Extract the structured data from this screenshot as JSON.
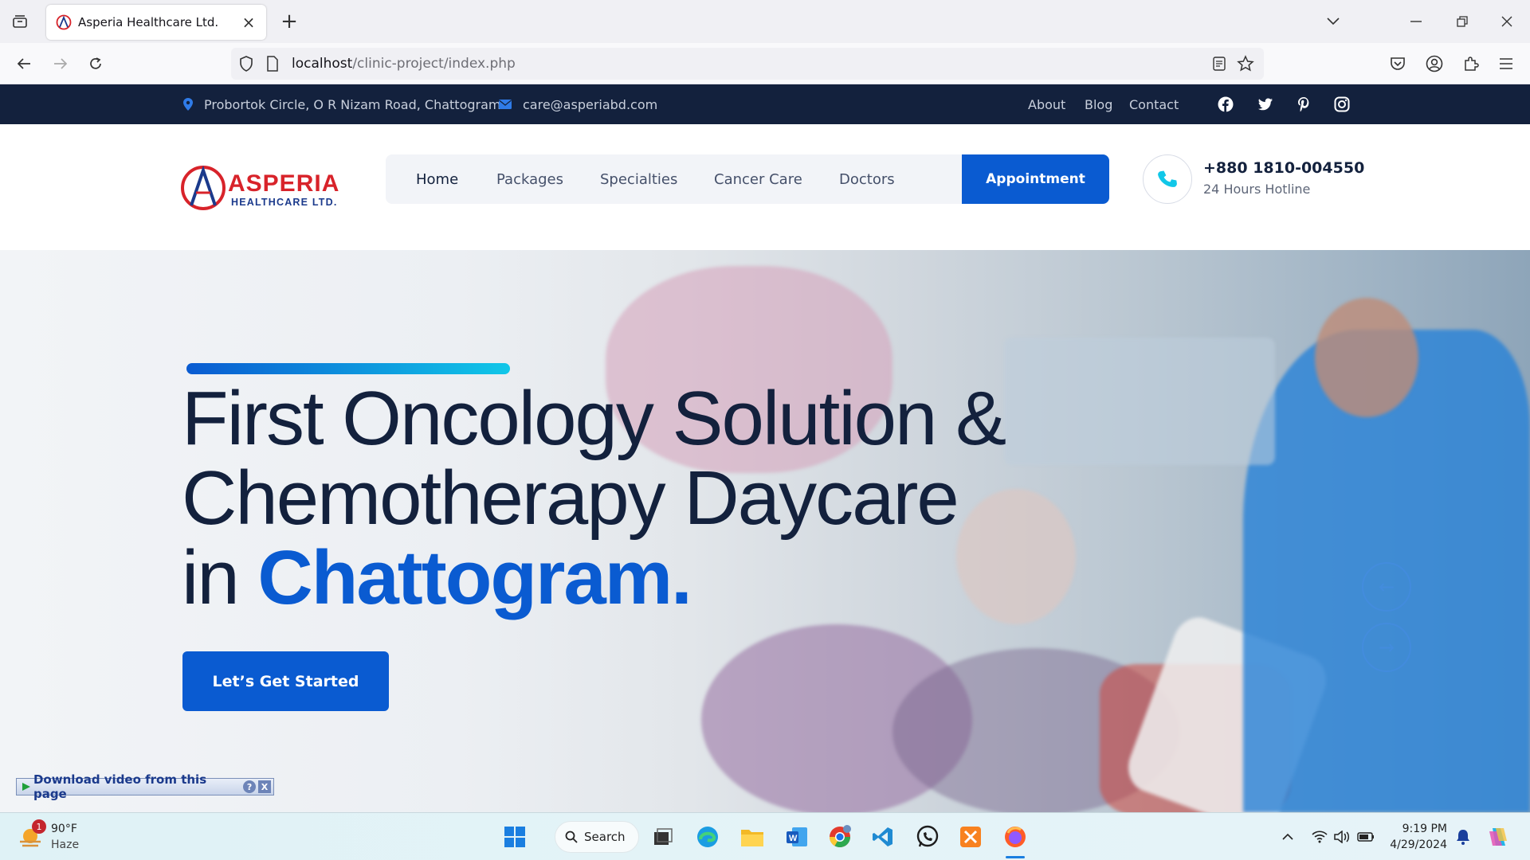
{
  "browser": {
    "tab_title": "Asperia Healthcare Ltd.",
    "tab_close": "×",
    "new_tab": "+",
    "url_host": "localhost",
    "url_path": "/clinic-project/index.php"
  },
  "topbar": {
    "address": "Probortok Circle, O R Nizam Road, Chattogram",
    "email": "care@asperiabd.com",
    "links": [
      "About",
      "Blog",
      "Contact"
    ],
    "social_icons": [
      "facebook-icon",
      "twitter-icon",
      "pinterest-icon",
      "instagram-icon"
    ]
  },
  "header": {
    "logo_text": "ASPERIA",
    "logo_sub": "HEALTHCARE LTD.",
    "nav": [
      "Home",
      "Packages",
      "Specialties",
      "Cancer Care",
      "Doctors"
    ],
    "active_nav": "Home",
    "appointment_label": "Appointment",
    "hotline_number": "+880 1810-004550",
    "hotline_label": "24 Hours Hotline"
  },
  "hero": {
    "title_line1": "First Oncology Solution &",
    "title_line2": "Chemotherapy Daycare",
    "title_line3_prefix": "in ",
    "title_highlight": "Chattogram.",
    "cta_label": "Let’s Get Started",
    "prev_arrow": "←",
    "next_arrow": "→"
  },
  "download_bar": {
    "label": "Download video from this page",
    "help": "?",
    "close": "X"
  },
  "taskbar": {
    "weather_temp": "90°F",
    "weather_desc": "Haze",
    "weather_badge": "1",
    "search_label": "Search",
    "time": "9:19 PM",
    "date": "4/29/2024"
  },
  "colors": {
    "brand_blue": "#0a5bd1",
    "navy": "#13213d",
    "accent_cyan": "#11c7e8",
    "logo_red": "#d8232a"
  }
}
